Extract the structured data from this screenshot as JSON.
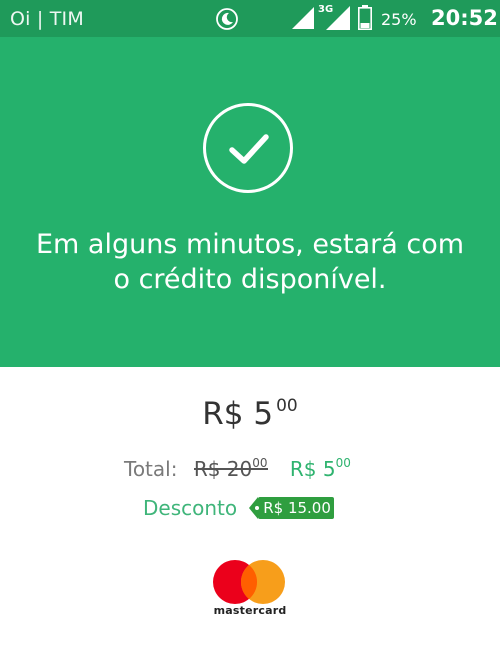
{
  "status_bar": {
    "carrier": "Oi | TIM",
    "network_type": "3G",
    "battery": "25%",
    "time": "20:52",
    "icons": [
      "moon-icon",
      "signal-icon",
      "signal-3g-icon",
      "battery-icon"
    ]
  },
  "hero": {
    "icon": "check-circle-icon",
    "message": "Em alguns minutos, estará com o crédito disponível."
  },
  "summary": {
    "amount_main": "R$ 5",
    "amount_cents": "00",
    "total_label": "Total:",
    "old_price_main": "R$ 20",
    "old_price_cents": "00",
    "new_price_main": "R$ 5",
    "new_price_cents": "00",
    "discount_label": "Desconto",
    "discount_value": "R$ 15.00"
  },
  "payment": {
    "brand": "mastercard",
    "icon": "mastercard-logo-icon"
  },
  "colors": {
    "status_bar": "#1f9a5a",
    "hero": "#25b16c",
    "accent_green": "#2fb36f",
    "discount_tag": "#2f9e3f",
    "mastercard_red": "#eb001b",
    "mastercard_orange": "#f79e1b"
  }
}
